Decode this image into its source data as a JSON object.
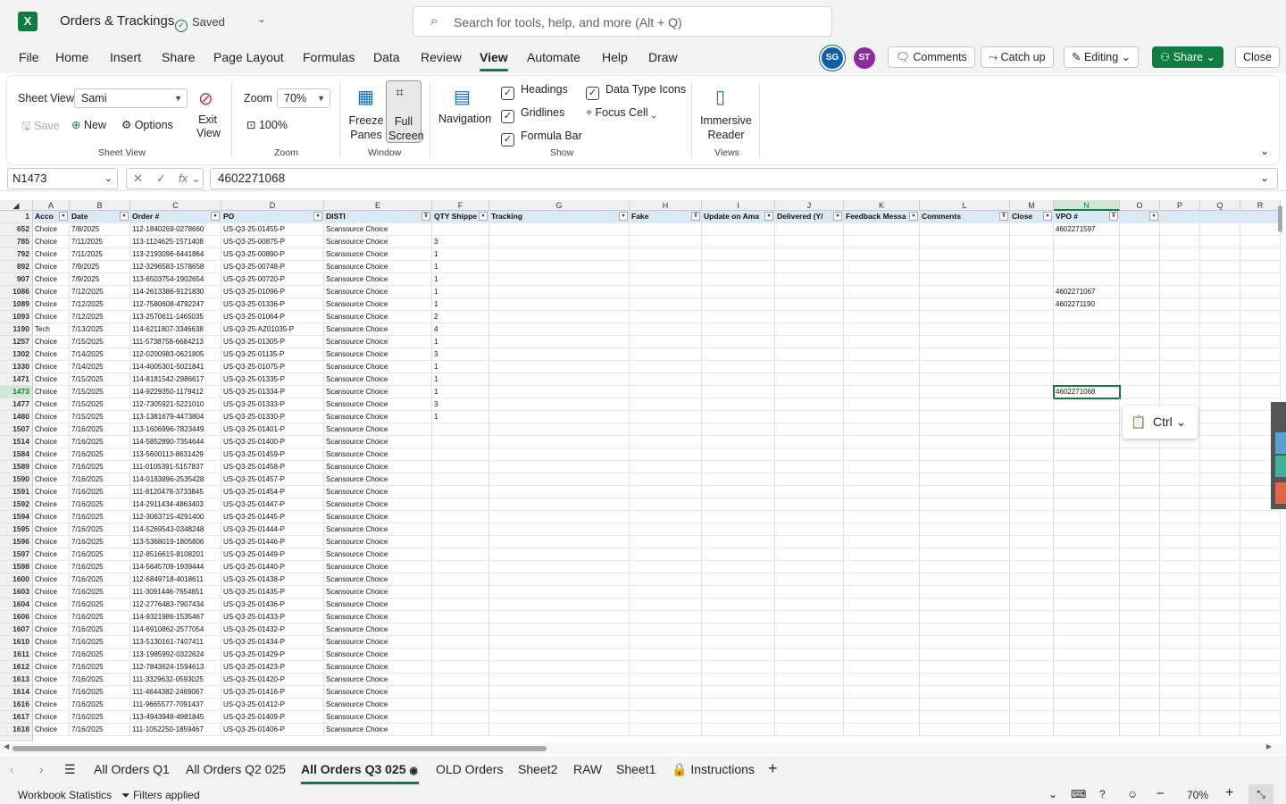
{
  "app": {
    "logo": "X",
    "title": "Orders & Trackings",
    "saved": "Saved",
    "search_placeholder": "Search for tools, help, and more (Alt + Q)"
  },
  "menu": [
    "File",
    "Home",
    "Insert",
    "Share",
    "Page Layout",
    "Formulas",
    "Data",
    "Review",
    "View",
    "Automate",
    "Help",
    "Draw"
  ],
  "menu_active": "View",
  "avatars": [
    {
      "initials": "SG",
      "color": "#0f5fa8"
    },
    {
      "initials": "ST",
      "color": "#8b2c9c"
    }
  ],
  "header_buttons": {
    "comments": "Comments",
    "catchup": "Catch up",
    "editing": "Editing",
    "share": "Share",
    "close": "Close"
  },
  "ribbon": {
    "sheet_view_label": "Sheet View",
    "sheet_view_value": "Sami",
    "save": "Save",
    "new": "New",
    "options": "Options",
    "exit_view": "Exit View",
    "sheet_view_group": "Sheet View",
    "zoom_label": "Zoom",
    "zoom_value": "70%",
    "zoom_100": "100%",
    "zoom_group": "Zoom",
    "freeze_panes": "Freeze Panes",
    "full_screen": "Full Screen",
    "window_group": "Window",
    "navigation": "Navigation",
    "headings": "Headings",
    "gridlines": "Gridlines",
    "formula_bar": "Formula Bar",
    "data_type_icons": "Data Type Icons",
    "focus_cell": "Focus Cell",
    "show_group": "Show",
    "immersive_reader": "Immersive Reader",
    "views_group": "Views"
  },
  "formula_bar": {
    "name_box": "N1473",
    "value": "4602271068"
  },
  "grid": {
    "columns": [
      "A",
      "B",
      "C",
      "D",
      "E",
      "F",
      "G",
      "H",
      "I",
      "J",
      "K",
      "L",
      "M",
      "N",
      "O",
      "P",
      "Q",
      "R"
    ],
    "header_row_number": "1",
    "headers": [
      "Acco",
      "Date",
      "Order #",
      "PO",
      "DISTI",
      "QTY Shippe",
      "Tracking",
      "Fake",
      "Update on Ama",
      "Delivered (Y/",
      "Feedback Messa",
      "Comments",
      "Close",
      "VPO #",
      "",
      "",
      "",
      ""
    ],
    "rows": [
      [
        "652",
        "Choice",
        "7/8/2025",
        "112-1840269-0278660",
        "US-Q3-25-01455-P",
        "Scansource Choice",
        "",
        "4602271597"
      ],
      [
        "785",
        "Choice",
        "7/11/2025",
        "113-1124625-1571408",
        "US-Q3-25-00875-P",
        "Scansource Choice",
        "3",
        ""
      ],
      [
        "792",
        "Choice",
        "7/11/2025",
        "113-2193096-6441864",
        "US-Q3-25-00890-P",
        "Scansource Choice",
        "1",
        ""
      ],
      [
        "892",
        "Choice",
        "7/9/2025",
        "112-3296583-1578658",
        "US-Q3-25-00748-P",
        "Scansource Choice",
        "1",
        ""
      ],
      [
        "907",
        "Choice",
        "7/9/2025",
        "113-6503754-1902654",
        "US-Q3-25-00720-P",
        "Scansource Choice",
        "1",
        ""
      ],
      [
        "1086",
        "Choice",
        "7/12/2025",
        "114-2613386-9121830",
        "US-Q3-25-01096-P",
        "Scansource Choice",
        "1",
        "4602271067"
      ],
      [
        "1089",
        "Choice",
        "7/12/2025",
        "112-7580608-4792247",
        "US-Q3-25-01336-P",
        "Scansource Choice",
        "1",
        "4602271190"
      ],
      [
        "1093",
        "Choice",
        "7/12/2025",
        "113-2570611-1465035",
        "US-Q3-25-01064-P",
        "Scansource Choice",
        "2",
        ""
      ],
      [
        "1190",
        "Tech",
        "7/13/2025",
        "114-6211807-3346638",
        "US-Q3-25-AZ01035-P",
        "Scansource Choice",
        "4",
        ""
      ],
      [
        "1257",
        "Choice",
        "7/15/2025",
        "111-5738758-6684213",
        "US-Q3-25-01305-P",
        "Scansource Choice",
        "1",
        ""
      ],
      [
        "1302",
        "Choice",
        "7/14/2025",
        "112-0200983-0621805",
        "US-Q3-25-01135-P",
        "Scansource Choice",
        "3",
        ""
      ],
      [
        "1330",
        "Choice",
        "7/14/2025",
        "114-4005301-5021841",
        "US-Q3-25-01075-P",
        "Scansource Choice",
        "1",
        ""
      ],
      [
        "1471",
        "Choice",
        "7/15/2025",
        "114-8181542-2986617",
        "US-Q3-25-01335-P",
        "Scansource Choice",
        "1",
        ""
      ],
      [
        "1473",
        "Choice",
        "7/15/2025",
        "114-9229350-1179412",
        "US-Q3-25-01334-P",
        "Scansource Choice",
        "1",
        "4602271068"
      ],
      [
        "1477",
        "Choice",
        "7/15/2025",
        "112-7305921-5221010",
        "US-Q3-25-01333-P",
        "Scansource Choice",
        "3",
        ""
      ],
      [
        "1480",
        "Choice",
        "7/15/2025",
        "113-1381679-4473804",
        "US-Q3-25-01330-P",
        "Scansource Choice",
        "1",
        ""
      ],
      [
        "1507",
        "Choice",
        "7/16/2025",
        "113-1606996-7823449",
        "US-Q3-25-01401-P",
        "Scansource Choice",
        "",
        ""
      ],
      [
        "1514",
        "Choice",
        "7/16/2025",
        "114-5852890-7354644",
        "US-Q3-25-01400-P",
        "Scansource Choice",
        "",
        ""
      ],
      [
        "1584",
        "Choice",
        "7/16/2025",
        "113-5600113-8631429",
        "US-Q3-25-01459-P",
        "Scansource Choice",
        "",
        ""
      ],
      [
        "1589",
        "Choice",
        "7/16/2025",
        "111-0105391-5157837",
        "US-Q3-25-01458-P",
        "Scansource Choice",
        "",
        ""
      ],
      [
        "1590",
        "Choice",
        "7/16/2025",
        "114-0183896-2535428",
        "US-Q3-25-01457-P",
        "Scansource Choice",
        "",
        ""
      ],
      [
        "1591",
        "Choice",
        "7/16/2025",
        "111-8120478-3733845",
        "US-Q3-25-01454-P",
        "Scansource Choice",
        "",
        ""
      ],
      [
        "1592",
        "Choice",
        "7/16/2025",
        "114-2911434-4863403",
        "US-Q3-25-01447-P",
        "Scansource Choice",
        "",
        ""
      ],
      [
        "1594",
        "Choice",
        "7/16/2025",
        "112-3063715-4291400",
        "US-Q3-25-01445-P",
        "Scansource Choice",
        "",
        ""
      ],
      [
        "1595",
        "Choice",
        "7/16/2025",
        "114-5269543-0348248",
        "US-Q3-25-01444-P",
        "Scansource Choice",
        "",
        ""
      ],
      [
        "1596",
        "Choice",
        "7/16/2025",
        "113-5368019-1805806",
        "US-Q3-25-01446-P",
        "Scansource Choice",
        "",
        ""
      ],
      [
        "1597",
        "Choice",
        "7/16/2025",
        "112-8516615-8108201",
        "US-Q3-25-01449-P",
        "Scansource Choice",
        "",
        ""
      ],
      [
        "1598",
        "Choice",
        "7/16/2025",
        "114-5645709-1939444",
        "US-Q3-25-01440-P",
        "Scansource Choice",
        "",
        ""
      ],
      [
        "1600",
        "Choice",
        "7/16/2025",
        "112-6849718-4018611",
        "US-Q3-25-01438-P",
        "Scansource Choice",
        "",
        ""
      ],
      [
        "1603",
        "Choice",
        "7/16/2025",
        "111-3091446-7654651",
        "US-Q3-25-01435-P",
        "Scansource Choice",
        "",
        ""
      ],
      [
        "1604",
        "Choice",
        "7/16/2025",
        "112-2776483-7907434",
        "US-Q3-25-01436-P",
        "Scansource Choice",
        "",
        ""
      ],
      [
        "1606",
        "Choice",
        "7/16/2025",
        "114-9321986-1535467",
        "US-Q3-25-01433-P",
        "Scansource Choice",
        "",
        ""
      ],
      [
        "1607",
        "Choice",
        "7/16/2025",
        "114-6910862-2577054",
        "US-Q3-25-01432-P",
        "Scansource Choice",
        "",
        ""
      ],
      [
        "1610",
        "Choice",
        "7/16/2025",
        "113-5130161-7407411",
        "US-Q3-25-01434-P",
        "Scansource Choice",
        "",
        ""
      ],
      [
        "1611",
        "Choice",
        "7/16/2025",
        "113-1985992-0322624",
        "US-Q3-25-01429-P",
        "Scansource Choice",
        "",
        ""
      ],
      [
        "1612",
        "Choice",
        "7/16/2025",
        "112-7843624-1594613",
        "US-Q3-25-01423-P",
        "Scansource Choice",
        "",
        ""
      ],
      [
        "1613",
        "Choice",
        "7/16/2025",
        "111-3329632-0593025",
        "US-Q3-25-01420-P",
        "Scansource Choice",
        "",
        ""
      ],
      [
        "1614",
        "Choice",
        "7/16/2025",
        "111-4644382-2469067",
        "US-Q3-25-01416-P",
        "Scansource Choice",
        "",
        ""
      ],
      [
        "1616",
        "Choice",
        "7/16/2025",
        "111-9665577-7091437",
        "US-Q3-25-01412-P",
        "Scansource Choice",
        "",
        ""
      ],
      [
        "1617",
        "Choice",
        "7/16/2025",
        "113-4943948-4981845",
        "US-Q3-25-01409-P",
        "Scansource Choice",
        "",
        ""
      ],
      [
        "1618",
        "Choice",
        "7/16/2025",
        "111-1052250-1859467",
        "US-Q3-25-01406-P",
        "Scansource Choice",
        "",
        ""
      ]
    ],
    "active_column": "N",
    "active_row": "1473"
  },
  "paste_popup": {
    "label": "Ctrl"
  },
  "sheet_tabs": [
    "All Orders Q1",
    "All Orders Q2 025",
    "All Orders Q3 025",
    "OLD Orders",
    "Sheet2",
    "RAW",
    "Sheet1",
    "Instructions"
  ],
  "active_tab": "All Orders Q3 025",
  "status": {
    "workbook_stats": "Workbook Statistics",
    "filters": "Filters applied",
    "zoom": "70%"
  }
}
